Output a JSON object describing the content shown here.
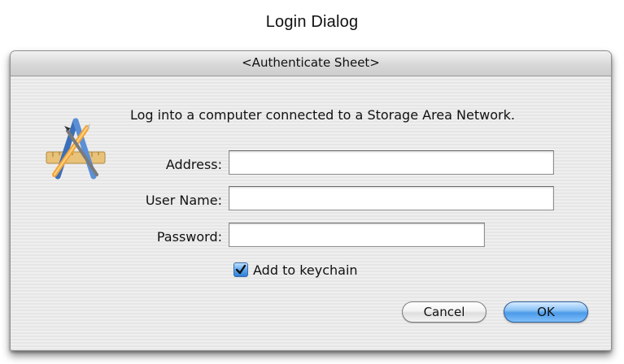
{
  "caption": "Login Dialog",
  "sheet": {
    "title": "<Authenticate Sheet>",
    "icon": "app-store-icon",
    "message": "Log into a computer connected to a Storage Area Network.",
    "fields": {
      "address": {
        "label": "Address:",
        "value": "",
        "placeholder": ""
      },
      "username": {
        "label": "User Name:",
        "value": "",
        "placeholder": ""
      },
      "password": {
        "label": "Password:",
        "value": "",
        "placeholder": ""
      }
    },
    "keychain": {
      "label": "Add to keychain",
      "checked": true
    },
    "buttons": {
      "cancel": "Cancel",
      "ok": "OK"
    }
  },
  "colors": {
    "ok_button": "#4b9ae8",
    "checkbox": "#2f80d6"
  }
}
